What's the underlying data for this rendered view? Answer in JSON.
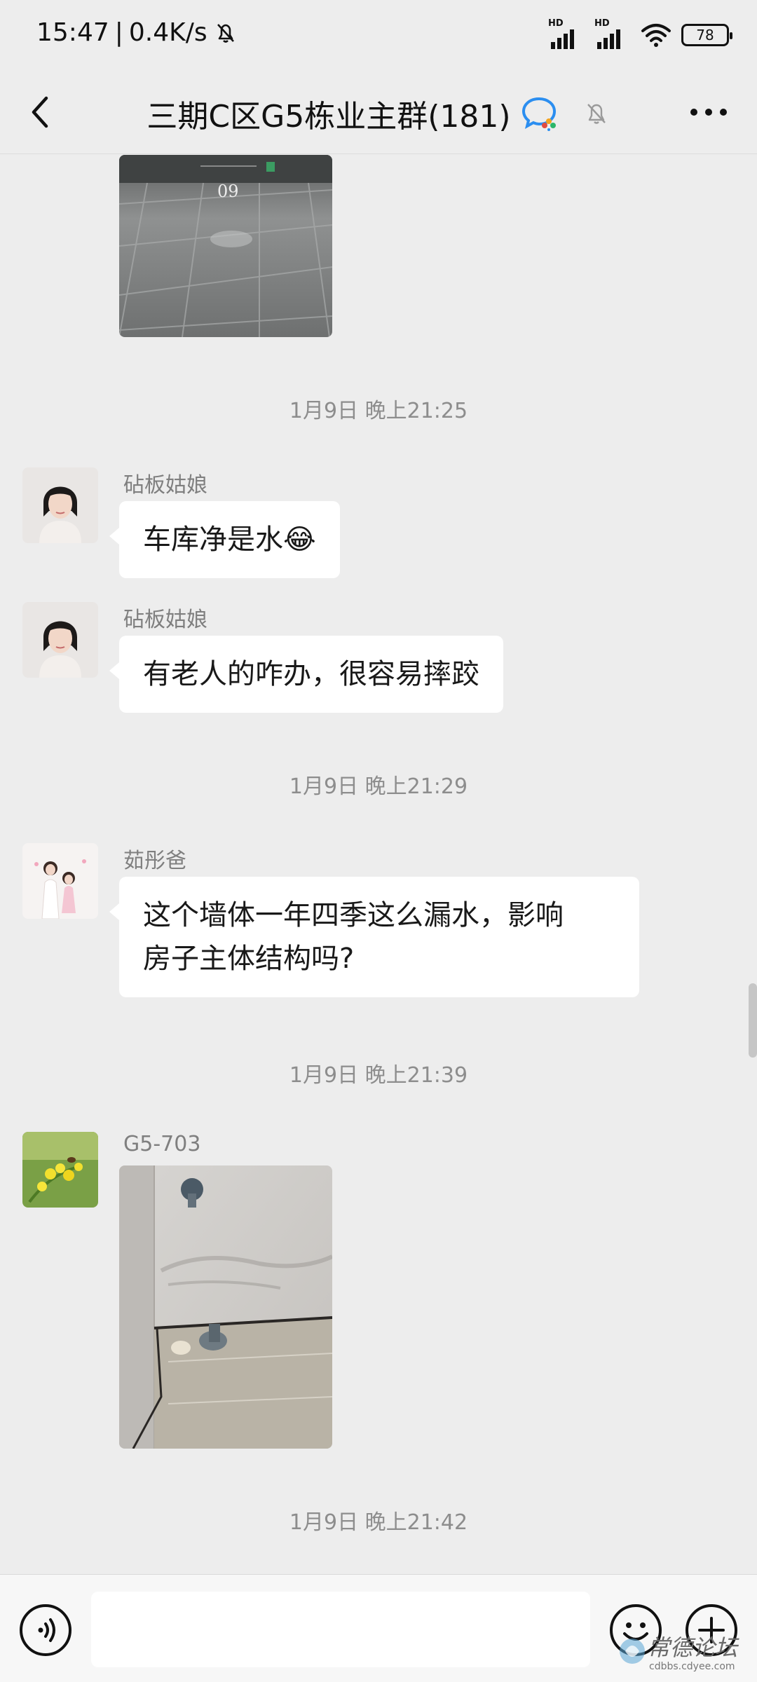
{
  "status_bar": {
    "time": "15:47",
    "separator": "|",
    "speed": "0.4K/s",
    "sim1_label": "HD",
    "sim2_label": "HD",
    "battery": "78"
  },
  "header": {
    "title": "三期C区G5栋业主群(181)"
  },
  "messages": {
    "image1_caption": "09",
    "ts1": "1月9日 晚上21:25",
    "m1_sender": "砧板姑娘",
    "m1_text": "车库净是水😂",
    "m2_sender": "砧板姑娘",
    "m2_text": "有老人的咋办，很容易摔跤",
    "ts2": "1月9日 晚上21:29",
    "m3_sender": "茹彤爸",
    "m3_line1": "这个墙体一年四季这么漏水，影响",
    "m3_line2": "房子主体结构吗?",
    "ts3": "1月9日 晚上21:39",
    "m4_sender": "G5-703",
    "ts4": "1月9日 晚上21:42"
  },
  "input": {
    "placeholder": ""
  },
  "watermark": {
    "text": "常德论坛",
    "url": "cdbbs.cdyee.com"
  },
  "icons": {
    "back": "chevron-left-icon",
    "group_chat": "wecom-chat-icon",
    "mute": "bell-off-icon",
    "more": "more-dots-icon",
    "voice": "voice-icon",
    "emoji": "emoji-icon",
    "plus": "plus-icon"
  }
}
